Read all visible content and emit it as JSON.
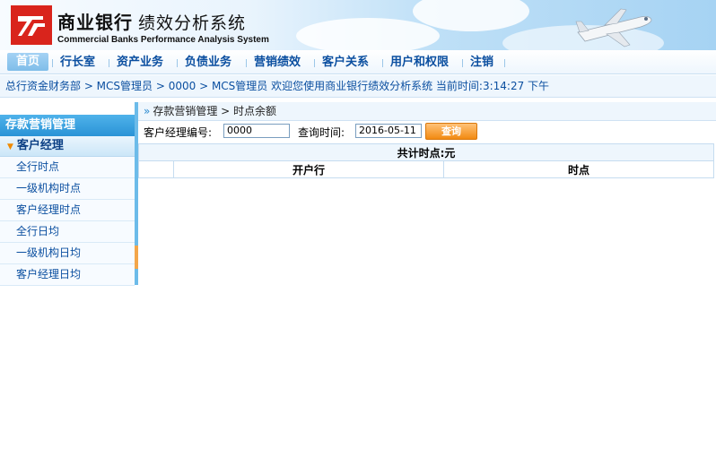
{
  "header": {
    "title_cn_a": "商业银行",
    "title_cn_b": "绩效分析系统",
    "title_en": "Commercial Banks  Performance Analysis System"
  },
  "nav": {
    "items": [
      {
        "label": "首页"
      },
      {
        "label": "行长室"
      },
      {
        "label": "资产业务"
      },
      {
        "label": "负债业务"
      },
      {
        "label": "营销绩效"
      },
      {
        "label": "客户关系"
      },
      {
        "label": "用户和权限"
      },
      {
        "label": "注销"
      }
    ]
  },
  "breadcrumb": {
    "text": "总行资金财务部 > MCS管理员 > 0000 > MCS管理员  欢迎您使用商业银行绩效分析系统   当前时间:3:14:27 下午"
  },
  "sidebar": {
    "section": "存款营销管理",
    "group": "客户经理",
    "items": [
      {
        "label": "全行时点"
      },
      {
        "label": "一级机构时点"
      },
      {
        "label": "客户经理时点"
      },
      {
        "label": "全行日均"
      },
      {
        "label": "一级机构日均"
      },
      {
        "label": "客户经理日均"
      }
    ]
  },
  "content": {
    "path_a": "存款营销管理",
    "path_b": "时点余额",
    "manager_label": "客户经理编号:",
    "manager_value": "0000",
    "date_label": "查询时间:",
    "date_value": "2016-05-11",
    "query_button": "查询",
    "total": "共计时点:元",
    "columns": [
      "",
      "开户行",
      "时点"
    ]
  },
  "colors": {
    "accent": "#2a93d6",
    "nav_text": "#0b4fa0",
    "button": "#f28a12",
    "logo": "#d9241c"
  }
}
